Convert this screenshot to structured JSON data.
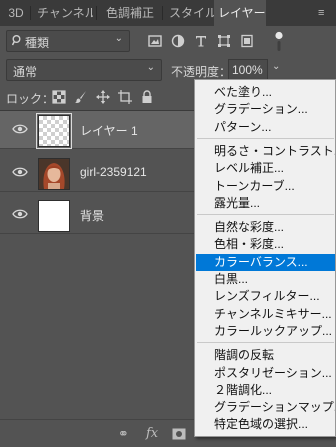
{
  "tabs": [
    {
      "label": "3D",
      "active": false
    },
    {
      "label": "チャンネル",
      "active": false
    },
    {
      "label": "色調補正",
      "active": false
    },
    {
      "label": "スタイル",
      "active": false
    },
    {
      "label": "レイヤー",
      "active": true
    }
  ],
  "filter": {
    "kind_label": "種類"
  },
  "blend": {
    "mode": "通常",
    "opacity_label": "不透明度：",
    "opacity_value": "100%"
  },
  "lock": {
    "label": "ロック："
  },
  "layers": [
    {
      "name": "レイヤー 1",
      "thumb": "transparent",
      "selected": true
    },
    {
      "name": "girl-2359121",
      "thumb": "photo",
      "selected": false
    },
    {
      "name": "背景",
      "thumb": "white",
      "selected": false
    }
  ],
  "menu": {
    "groups": [
      [
        "べた塗り...",
        "グラデーション...",
        "パターン..."
      ],
      [
        "明るさ・コントラスト...",
        "レベル補正...",
        "トーンカーブ...",
        "露光量..."
      ],
      [
        "自然な彩度...",
        "色相・彩度...",
        "カラーバランス...",
        "白黒...",
        "レンズフィルター...",
        "チャンネルミキサー...",
        "カラールックアップ..."
      ],
      [
        "階調の反転",
        "ポスタリゼーション...",
        "２階調化...",
        "グラデーションマップ...",
        "特定色域の選択..."
      ]
    ],
    "highlighted": "カラーバランス..."
  },
  "colors": {
    "panel": "#535353",
    "tabbar": "#3a3a3a",
    "selected_row": "#656565",
    "menu_bg": "#f0f0f0",
    "highlight": "#0078d7"
  }
}
